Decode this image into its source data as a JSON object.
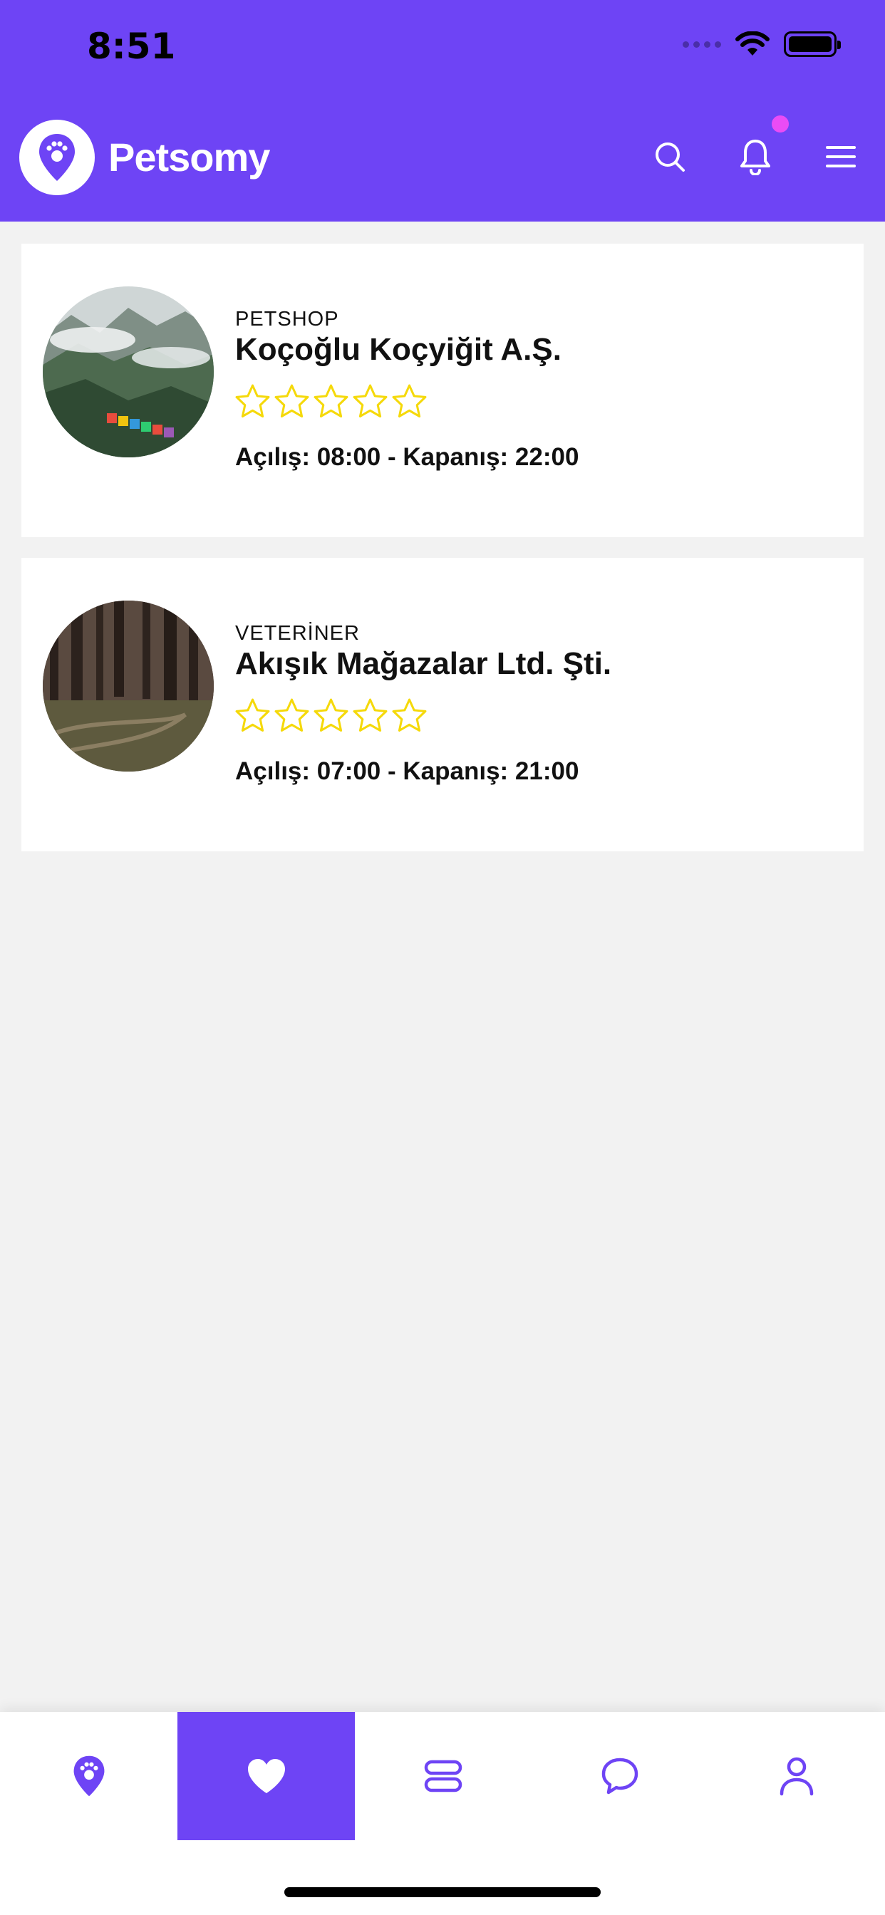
{
  "status_bar": {
    "time": "8:51"
  },
  "header": {
    "brand": "Petsomy",
    "icons": [
      "search-icon",
      "bell-icon",
      "menu-icon"
    ],
    "bg_color": "#6e44f5",
    "notification_dot_color": "#ea4cf5"
  },
  "listings": [
    {
      "category": "PETSHOP",
      "name": "Koçoğlu Koçyiğit A.Ş.",
      "rating": 0,
      "max_rating": 5,
      "hours": "Açılış: 08:00 - Kapanış: 22:00"
    },
    {
      "category": "VETERİNER",
      "name": "Akışık Mağazalar Ltd. Şti.",
      "rating": 0,
      "max_rating": 5,
      "hours": "Açılış: 07:00 - Kapanış: 21:00"
    }
  ],
  "bottom_nav": {
    "items": [
      {
        "icon": "map-pin-paw-icon"
      },
      {
        "icon": "heart-icon",
        "active": true
      },
      {
        "icon": "list-icon"
      },
      {
        "icon": "chat-bubble-icon"
      },
      {
        "icon": "user-icon"
      }
    ],
    "active_color": "#6e44f5"
  },
  "colors": {
    "star": "#f5d90a",
    "accent": "#6e44f5"
  }
}
